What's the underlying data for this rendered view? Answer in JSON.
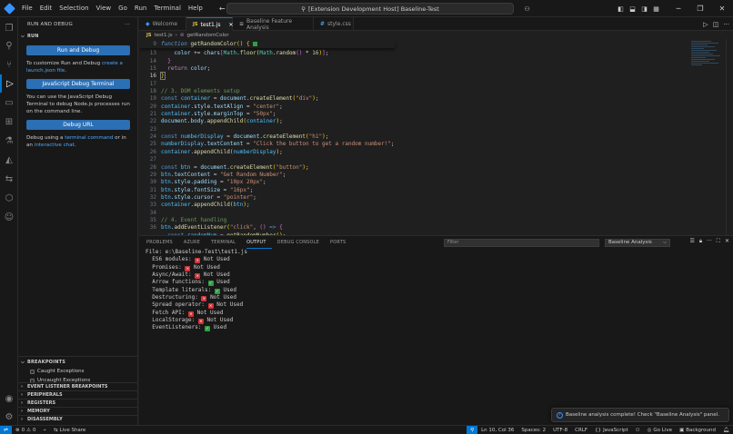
{
  "titlebar": {
    "menus": [
      "File",
      "Edit",
      "Selection",
      "View",
      "Go",
      "Run",
      "Terminal",
      "Help"
    ],
    "command_center": "[Extension Development Host] Baseline-Test"
  },
  "sidebar": {
    "title": "RUN AND DEBUG",
    "run_section": "RUN",
    "run_debug_button": "Run and Debug",
    "customize_text_pre": "To customize Run and Debug ",
    "customize_link": "create a launch.json file",
    "customize_text_post": ".",
    "js_terminal_button": "JavaScript Debug Terminal",
    "terminal_text": "You can use the JavaScript Debug Terminal to debug Node.js processes run on the command line.",
    "debug_url_button": "Debug URL",
    "debug_using_pre": "Debug using a ",
    "debug_using_link1": "terminal command",
    "debug_using_mid": " or in an ",
    "debug_using_link2": "interactive chat",
    "debug_using_post": ".",
    "breakpoints_section": "BREAKPOINTS",
    "caught_exceptions": "Caught Exceptions",
    "uncaught_exceptions": "Uncaught Exceptions",
    "event_listener_bp": "EVENT LISTENER BREAKPOINTS",
    "peripherals": "PERIPHERALS",
    "registers": "REGISTERS",
    "memory": "MEMORY",
    "disassembly": "DISASSEMBLY"
  },
  "tabs": [
    {
      "label": "Welcome",
      "icon": "vscode-icon"
    },
    {
      "label": "test1.js",
      "icon": "js-icon",
      "active": true
    },
    {
      "label": "Baseline Feature Analysis",
      "icon": "preview-icon"
    },
    {
      "label": "style.css",
      "icon": "css-icon"
    }
  ],
  "breadcrumb": {
    "file": "test1.js",
    "symbol": "getRandomColor"
  },
  "editor": {
    "sticky_line_no": "9",
    "line_numbers": [
      "13",
      "14",
      "15",
      "16",
      "17",
      "18",
      "19",
      "20",
      "21",
      "22",
      "23",
      "24",
      "25",
      "26",
      "27",
      "28",
      "29",
      "30",
      "31",
      "32",
      "33",
      "34",
      "35",
      "36"
    ],
    "current_line": "16"
  },
  "panel": {
    "tabs": [
      "PROBLEMS",
      "AZURE",
      "TERMINAL",
      "OUTPUT",
      "DEBUG CONSOLE",
      "PORTS"
    ],
    "active_tab": "OUTPUT",
    "filter_placeholder": "Filter",
    "output_channel": "Baseline Analysis",
    "output_header": "File: e:\\Baseline-Test\\test1.js",
    "output_lines": [
      {
        "feature": "ES6 modules:",
        "status": "Not Used",
        "used": false
      },
      {
        "feature": "Promises:",
        "status": "Not Used",
        "used": false
      },
      {
        "feature": "Async/Await:",
        "status": "Not Used",
        "used": false
      },
      {
        "feature": "Arrow functions:",
        "status": "Used",
        "used": true
      },
      {
        "feature": "Template literals:",
        "status": "Used",
        "used": true
      },
      {
        "feature": "Destructuring:",
        "status": "Not Used",
        "used": false
      },
      {
        "feature": "Spread operator:",
        "status": "Not Used",
        "used": false
      },
      {
        "feature": "Fetch API:",
        "status": "Not Used",
        "used": false
      },
      {
        "feature": "LocalStorage:",
        "status": "Not Used",
        "used": false
      },
      {
        "feature": "EventListeners:",
        "status": "Used",
        "used": true
      }
    ]
  },
  "notification": {
    "message": "Baseline analysis complete! Check \"Baseline Analysis\" panel."
  },
  "statusbar": {
    "errors": "0",
    "warnings": "0",
    "live_share": "Live Share",
    "cursor": "Ln 10, Col 36",
    "spaces": "Spaces: 2",
    "encoding": "UTF-8",
    "eol": "CRLF",
    "language": "JavaScript",
    "go_live": "Go Live",
    "background": "Background"
  },
  "colors": {
    "accent": "#0078d4",
    "button": "#2b6fb5",
    "link": "#4daafc",
    "error_badge": "#d13438",
    "ok_badge": "#2ea043"
  }
}
